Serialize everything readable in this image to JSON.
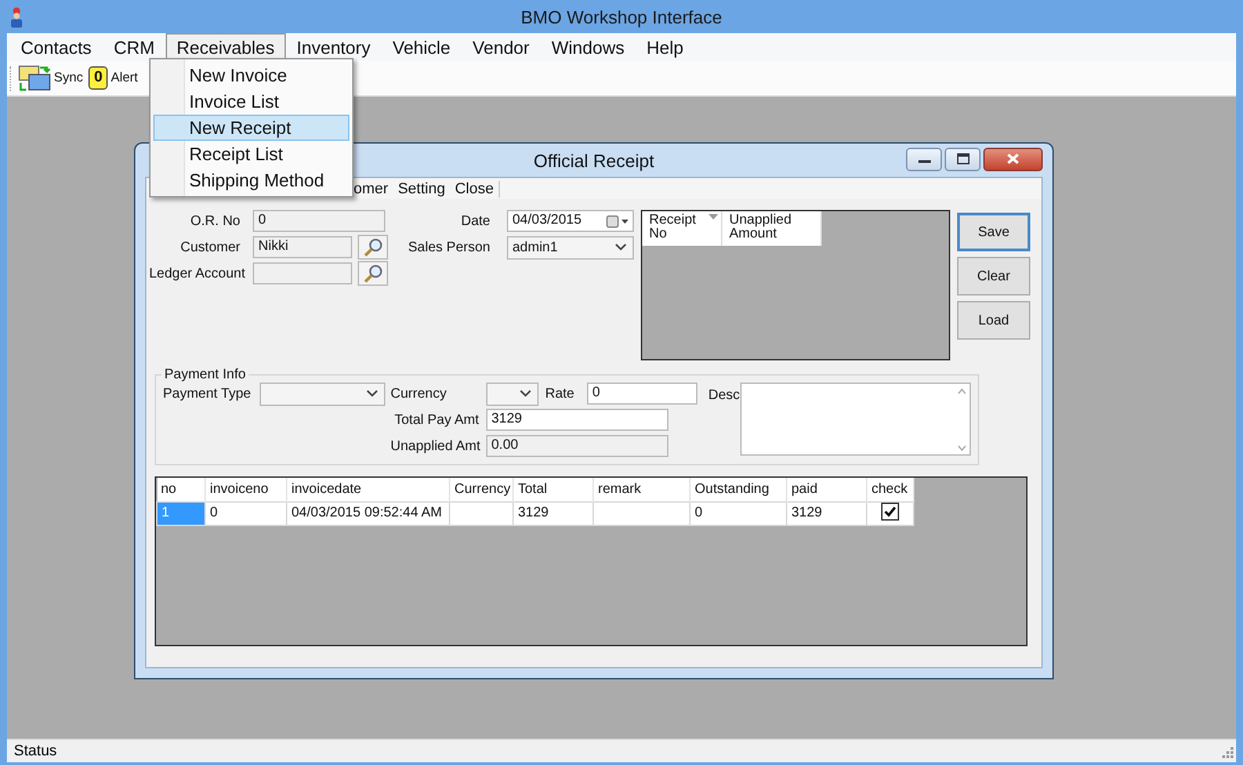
{
  "window": {
    "title": "BMO Workshop Interface"
  },
  "menu_bar": [
    {
      "label": "Contacts",
      "selected": false
    },
    {
      "label": "CRM",
      "selected": false
    },
    {
      "label": "Receivables",
      "selected": true
    },
    {
      "label": "Inventory",
      "selected": false
    },
    {
      "label": "Vehicle",
      "selected": false
    },
    {
      "label": "Vendor",
      "selected": false
    },
    {
      "label": "Windows",
      "selected": false
    },
    {
      "label": "Help",
      "selected": false
    }
  ],
  "toolbar": [
    {
      "kind": "sync",
      "label": "Sync"
    },
    {
      "kind": "alert",
      "label": "Alert",
      "badge": "0"
    }
  ],
  "receivables_menu": [
    {
      "label": "New Invoice",
      "selected": false
    },
    {
      "label": "Invoice List",
      "selected": false
    },
    {
      "label": "New Receipt",
      "selected": true
    },
    {
      "label": "Receipt List",
      "selected": false
    },
    {
      "label": "Shipping Method",
      "selected": false
    }
  ],
  "receipt_window": {
    "title": "Official Receipt",
    "menu": [
      "omer",
      "Setting",
      "Close"
    ],
    "customer_fields": [
      {
        "label": "O.R. No",
        "value": "0",
        "readonly": true,
        "lookup": false
      },
      {
        "label": "Customer",
        "value": "Nikki",
        "readonly": true,
        "lookup": true
      },
      {
        "label": "Ledger Account",
        "readonly": true,
        "lookup": true
      }
    ],
    "date": {
      "label": "Date",
      "value": "04/03/2015"
    },
    "sales_person": {
      "label": "Sales Person",
      "value": "admin1"
    },
    "receipts_grid": {
      "columns": [
        {
          "label": "Receipt No",
          "sorted": true
        },
        {
          "label": "Unapplied Amount",
          "sorted": false
        }
      ]
    },
    "buttons": [
      {
        "label": "Save",
        "focused": true
      },
      {
        "label": "Clear",
        "focused": false
      },
      {
        "label": "Load",
        "focused": false
      }
    ],
    "payment_info": {
      "title": "Payment Info",
      "payment_type": {
        "label": "Payment Type"
      },
      "currency": {
        "label": "Currency"
      },
      "rate": {
        "label": "Rate",
        "value": "0",
        "readonly": false
      },
      "total_pay_amt": {
        "label": "Total Pay Amt",
        "value": "3129",
        "readonly": false
      },
      "unapplied_amt": {
        "label": "Unapplied Amt",
        "value": "0.00",
        "readonly": true
      },
      "desc": {
        "label": "Desc"
      }
    },
    "invoice_grid": {
      "columns": [
        "no",
        "invoiceno",
        "invoicedate",
        "Currency",
        "Total",
        "remark",
        "Outstanding",
        "paid",
        "check"
      ],
      "rows": [
        {
          "cells": [
            "1",
            "0",
            "04/03/2015 09:52:44 AM",
            null,
            "3129",
            null,
            "0",
            "3129"
          ],
          "checked": true,
          "selected": true
        }
      ]
    }
  },
  "status_bar": {
    "text": "Status"
  }
}
